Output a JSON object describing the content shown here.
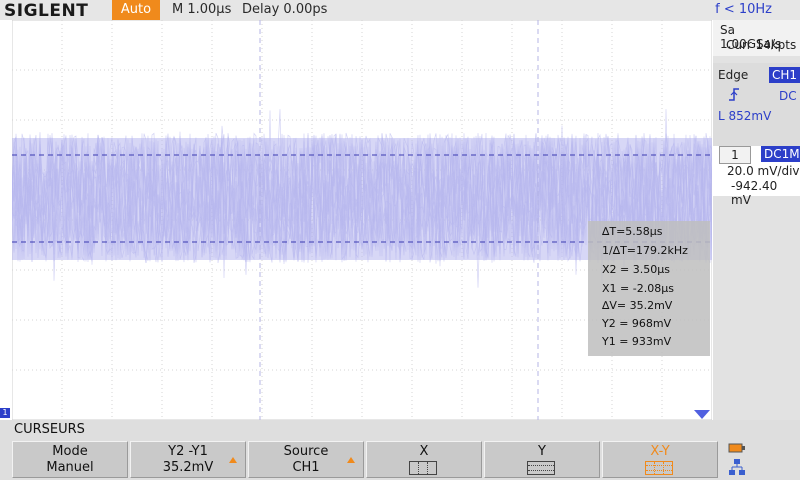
{
  "header": {
    "brand": "SIGLENT",
    "trigger_mode": "Auto",
    "timebase": "M 1.00μs",
    "delay": "Delay 0.00ps",
    "frequency": "f < 10Hz"
  },
  "acquisition": {
    "sample_rate": "Sa 1.00GSa/s",
    "memory": "Curr 14kpts"
  },
  "trigger": {
    "type": "Edge",
    "source": "CH1",
    "slope_icon": "rising-edge-icon",
    "coupling": "DC",
    "level": "L  852mV"
  },
  "channel": {
    "number": "1",
    "coupling": "DC1M",
    "scale": "20.0 mV/div",
    "offset": "-942.40 mV"
  },
  "measurements": {
    "delta_t": "∆T=5.58μs",
    "inv_delta_t": "1/∆T=179.2kHz",
    "x2": "X2 = 3.50μs",
    "x1": "X1 = -2.08μs",
    "delta_v": "∆V= 35.2mV",
    "y2": "Y2 = 968mV",
    "y1": "Y1 = 933mV"
  },
  "channel_marker": "1",
  "menu": {
    "title": "CURSEURS",
    "buttons": [
      {
        "line1": "Mode",
        "line2": "Manuel"
      },
      {
        "line1": "Y2 -Y1",
        "line2": "35.2mV"
      },
      {
        "line1": "Source",
        "line2": "CH1"
      },
      {
        "line1": "X",
        "line2": ""
      },
      {
        "line1": "Y",
        "line2": ""
      },
      {
        "line1": "X-Y",
        "line2": ""
      }
    ]
  },
  "colors": {
    "accent": "#f08a1c",
    "channel_blue": "#2c3fc9",
    "waveform": "#b7b7ef",
    "cursor": "#3a3ab0"
  }
}
